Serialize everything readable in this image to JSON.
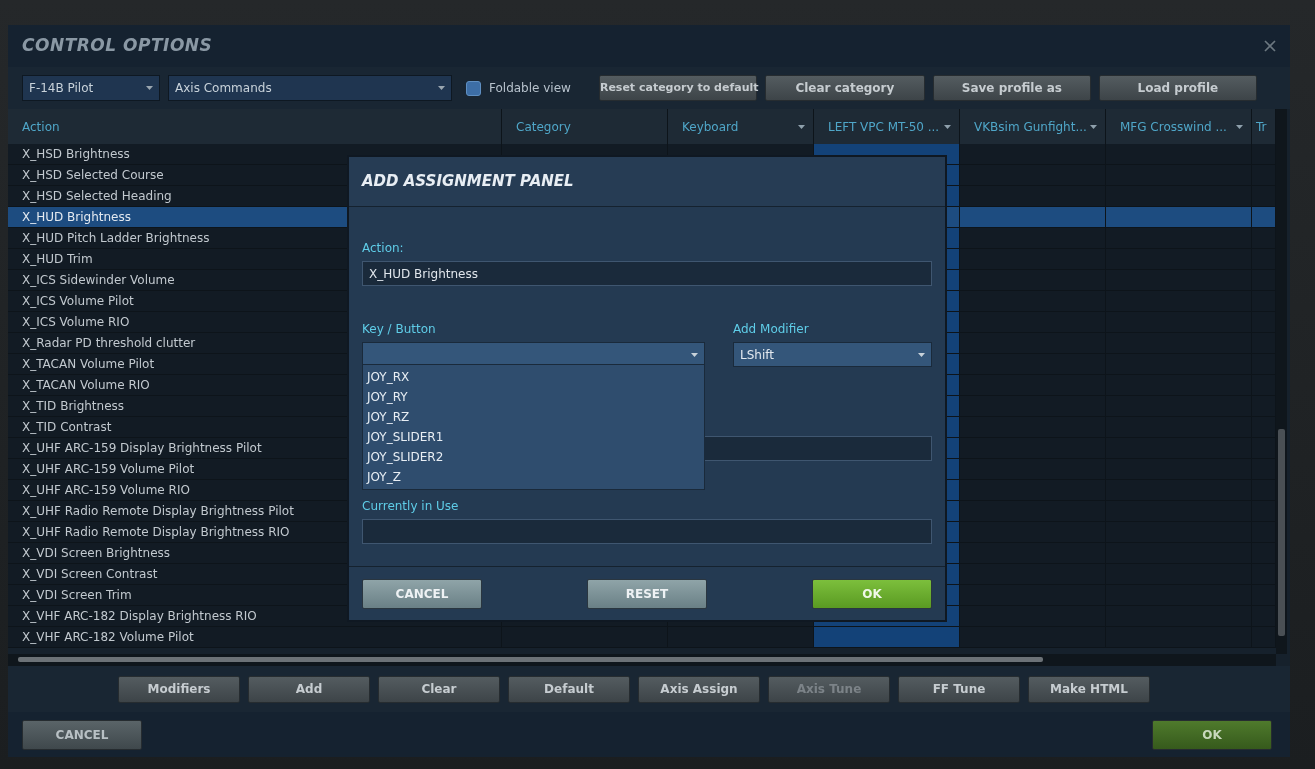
{
  "window": {
    "title": "CONTROL OPTIONS"
  },
  "toolbar": {
    "aircraft_select": {
      "value": "F-14B Pilot"
    },
    "category_select": {
      "value": "Axis Commands"
    },
    "foldable_view": {
      "label": "Foldable view",
      "checked": false
    },
    "buttons": [
      "Reset category to default",
      "Clear category",
      "Save profile as",
      "Load profile"
    ]
  },
  "table": {
    "columns": [
      {
        "label": "Action",
        "dropdown": false,
        "selected": false
      },
      {
        "label": "Category",
        "dropdown": false,
        "selected": false
      },
      {
        "label": "Keyboard",
        "dropdown": true,
        "selected": false
      },
      {
        "label": "LEFT VPC MT-50 ...",
        "dropdown": true,
        "selected": true
      },
      {
        "label": "VKBsim Gunfight...",
        "dropdown": true,
        "selected": false
      },
      {
        "label": "MFG Crosswind ...",
        "dropdown": true,
        "selected": false
      },
      {
        "label": "Tr",
        "dropdown": false,
        "selected": false
      }
    ],
    "rows": [
      {
        "action": "X_HSD Brightness",
        "selected": false
      },
      {
        "action": "X_HSD Selected Course",
        "selected": false
      },
      {
        "action": "X_HSD Selected Heading",
        "selected": false
      },
      {
        "action": "X_HUD Brightness",
        "selected": true
      },
      {
        "action": "X_HUD Pitch Ladder Brightness",
        "selected": false
      },
      {
        "action": "X_HUD Trim",
        "selected": false
      },
      {
        "action": "X_ICS Sidewinder Volume",
        "selected": false
      },
      {
        "action": "X_ICS Volume Pilot",
        "selected": false
      },
      {
        "action": "X_ICS Volume RIO",
        "selected": false
      },
      {
        "action": "X_Radar PD threshold clutter",
        "selected": false
      },
      {
        "action": "X_TACAN Volume Pilot",
        "selected": false
      },
      {
        "action": "X_TACAN Volume RIO",
        "selected": false
      },
      {
        "action": "X_TID Brightness",
        "selected": false
      },
      {
        "action": "X_TID Contrast",
        "selected": false
      },
      {
        "action": "X_UHF ARC-159 Display Brightness Pilot",
        "selected": false
      },
      {
        "action": "X_UHF ARC-159 Volume Pilot",
        "selected": false
      },
      {
        "action": "X_UHF ARC-159 Volume RIO",
        "selected": false
      },
      {
        "action": "X_UHF Radio Remote Display Brightness Pilot",
        "selected": false
      },
      {
        "action": "X_UHF Radio Remote Display Brightness RIO",
        "selected": false
      },
      {
        "action": "X_VDI Screen Brightness",
        "selected": false
      },
      {
        "action": "X_VDI Screen Contrast",
        "selected": false
      },
      {
        "action": "X_VDI Screen Trim",
        "selected": false
      },
      {
        "action": "X_VHF ARC-182 Display Brightness RIO",
        "selected": false
      },
      {
        "action": "X_VHF ARC-182 Volume Pilot",
        "selected": false
      }
    ]
  },
  "modal": {
    "title": "ADD ASSIGNMENT PANEL",
    "action_label": "Action:",
    "action_value": "X_HUD Brightness",
    "key_label": "Key / Button",
    "modifier_label": "Add Modifier",
    "modifier_value": "LShift",
    "key_options": [
      "JOY_RX",
      "JOY_RY",
      "JOY_RZ",
      "JOY_SLIDER1",
      "JOY_SLIDER2",
      "JOY_Z"
    ],
    "in_use_label": "Currently in Use",
    "buttons": [
      {
        "label": "CANCEL",
        "kind": "secondary"
      },
      {
        "label": "RESET",
        "kind": "secondary"
      },
      {
        "label": "OK",
        "kind": "primary"
      }
    ]
  },
  "action_buttons": [
    {
      "label": "Modifiers",
      "disabled": false
    },
    {
      "label": "Add",
      "disabled": false
    },
    {
      "label": "Clear",
      "disabled": false
    },
    {
      "label": "Default",
      "disabled": false
    },
    {
      "label": "Axis Assign",
      "disabled": false
    },
    {
      "label": "Axis Tune",
      "disabled": true
    },
    {
      "label": "FF Tune",
      "disabled": false
    },
    {
      "label": "Make HTML",
      "disabled": false
    }
  ],
  "footer": {
    "buttons": [
      {
        "label": "CANCEL",
        "kind": "secondary"
      },
      {
        "label": "OK",
        "kind": "primary"
      }
    ]
  }
}
